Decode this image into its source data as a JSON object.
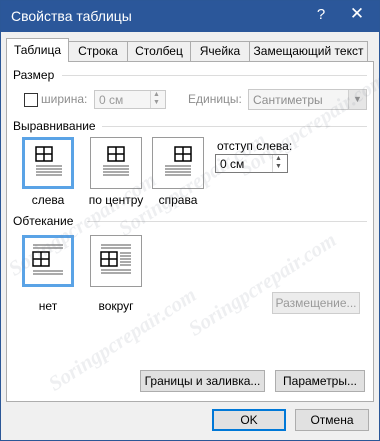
{
  "window": {
    "title": "Свойства таблицы",
    "help_glyph": "?",
    "close_glyph": "✕"
  },
  "tabs": [
    {
      "label": "Таблица",
      "active": true
    },
    {
      "label": "Строка",
      "active": false
    },
    {
      "label": "Столбец",
      "active": false
    },
    {
      "label": "Ячейка",
      "active": false
    },
    {
      "label": "Замещающий текст",
      "active": false
    }
  ],
  "size": {
    "heading": "Размер",
    "width_checkbox_label": "ширина:",
    "width_checked": false,
    "width_value": "0 см",
    "units_label": "Единицы:",
    "units_value": "Сантиметры"
  },
  "alignment": {
    "heading": "Выравнивание",
    "options": [
      {
        "label": "слева",
        "selected": true,
        "icon": "table-align-left-icon"
      },
      {
        "label": "по центру",
        "selected": false,
        "icon": "table-align-center-icon"
      },
      {
        "label": "справа",
        "selected": false,
        "icon": "table-align-right-icon"
      }
    ],
    "indent_label": "отступ слева:",
    "indent_value": "0 см"
  },
  "wrapping": {
    "heading": "Обтекание",
    "options": [
      {
        "label": "нет",
        "selected": true,
        "icon": "wrap-none-icon"
      },
      {
        "label": "вокруг",
        "selected": false,
        "icon": "wrap-around-icon"
      }
    ],
    "positioning_button": "Размещение..."
  },
  "buttons": {
    "borders": "Границы и заливка...",
    "options": "Параметры...",
    "ok": "OK",
    "cancel": "Отмена"
  },
  "watermark": "Soringpcrepair.com",
  "colors": {
    "titlebar": "#2b579a",
    "selection": "#5aa3e6",
    "default_button_border": "#0078d7"
  }
}
